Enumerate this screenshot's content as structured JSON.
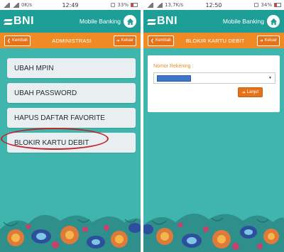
{
  "left_screen": {
    "status": {
      "speed": "0K/s",
      "time": "12:49",
      "battery": "33%"
    },
    "brand": {
      "logo": "BNI",
      "app_name": "Mobile Banking"
    },
    "nav": {
      "back_label": "Kembali",
      "title": "ADMINISTRASI",
      "logout_label": "Keluar"
    },
    "menu": [
      {
        "label": "UBAH MPIN"
      },
      {
        "label": "UBAH PASSWORD"
      },
      {
        "label": "HAPUS DAFTAR FAVORITE"
      },
      {
        "label": "BLOKIR KARTU DEBIT"
      }
    ]
  },
  "right_screen": {
    "status": {
      "speed": "13,7K/s",
      "time": "12:50",
      "battery": "34%"
    },
    "brand": {
      "logo": "BNI",
      "app_name": "Mobile Banking"
    },
    "nav": {
      "back_label": "Kembali",
      "title": "BLOKIR KARTU DEBIT",
      "logout_label": "Keluar"
    },
    "form": {
      "account_label": "Nomor Rekening :",
      "submit_label": "Lanjut"
    }
  },
  "colors": {
    "teal": "#3fb5ad",
    "brand_teal": "#1d9f97",
    "orange": "#f08a24",
    "highlight": "#c0272d",
    "redacted": "#3d73c9"
  }
}
